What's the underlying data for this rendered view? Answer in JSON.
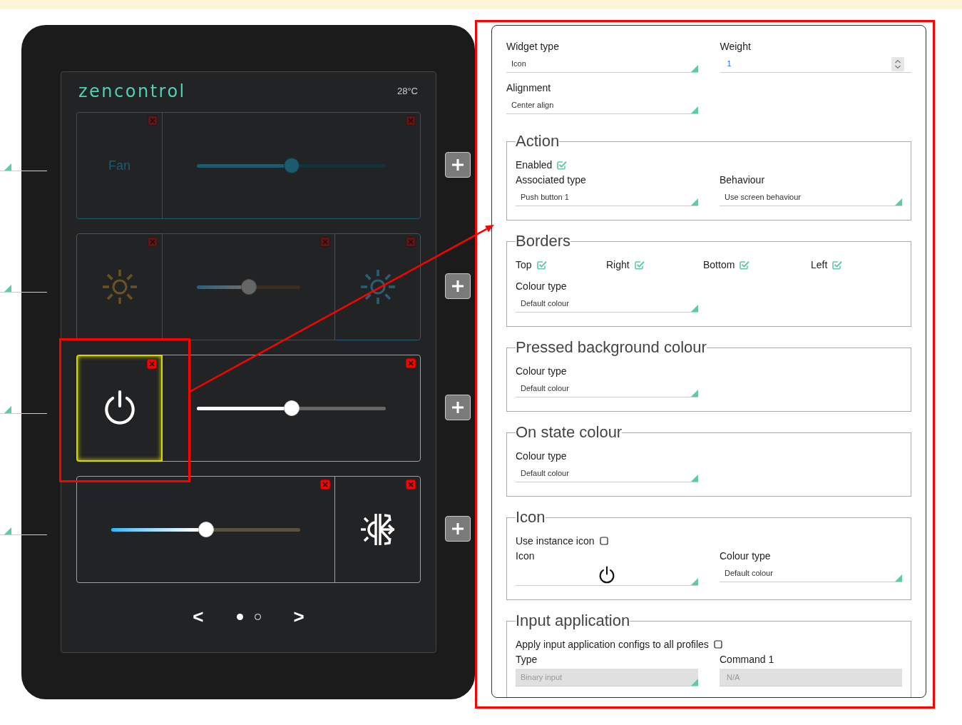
{
  "device": {
    "logo": "zencontrol",
    "temperature": "28°C",
    "rows": [
      {
        "dimmed": true,
        "tiles": [
          {
            "kind": "label",
            "text": "Fan",
            "color": "#1e5a6e",
            "selected": false
          },
          {
            "kind": "slider",
            "slider": {
              "kind": "accent",
              "level": 0.5
            },
            "color": "#1e5a6e",
            "selected": false
          }
        ]
      },
      {
        "dimmed": true,
        "tiles": [
          {
            "kind": "sun",
            "color": "#6b5022",
            "selected": false
          },
          {
            "kind": "slider",
            "slider": {
              "kind": "dual",
              "level": 0.5
            },
            "selected": false
          },
          {
            "kind": "sun",
            "color": "#2b5d72",
            "selected": false
          }
        ]
      },
      {
        "dimmed": false,
        "tiles": [
          {
            "kind": "power",
            "selected": true
          },
          {
            "kind": "slider",
            "slider": {
              "kind": "plain",
              "level": 0.5
            },
            "selected": false
          }
        ]
      },
      {
        "dimmed": false,
        "tiles": [
          {
            "kind": "slider",
            "slider": {
              "kind": "temperature",
              "level": 0.5
            },
            "selected": false
          },
          {
            "kind": "climate",
            "selected": false
          }
        ]
      }
    ],
    "pager": {
      "previous": "<",
      "next": ">",
      "pages": [
        {
          "selected": true
        },
        {
          "selected": false
        }
      ]
    }
  },
  "settings": {
    "rows": [
      {
        "items": [
          {
            "kind": "select",
            "label": "Widget type",
            "value": "Icon",
            "disabled": false
          },
          {
            "kind": "number",
            "label": "Weight",
            "value": "1",
            "disabled": false
          }
        ]
      },
      {
        "items": [
          {
            "kind": "select",
            "label": "Alignment",
            "value": "Center align",
            "disabled": false
          }
        ]
      }
    ],
    "sections": [
      {
        "title": "Action",
        "rows": [
          {
            "items": [
              {
                "kind": "checkbox",
                "label": "Enabled",
                "checked": true
              }
            ]
          },
          {
            "items": [
              {
                "kind": "select",
                "label": "Associated type",
                "value": "Push button 1",
                "disabled": false
              },
              {
                "kind": "select",
                "label": "Behaviour",
                "value": "Use screen behaviour",
                "disabled": false
              }
            ]
          }
        ]
      },
      {
        "title": "Borders",
        "rows": [
          {
            "items": [
              {
                "kind": "checkbox",
                "label": "Top",
                "checked": true
              },
              {
                "kind": "checkbox",
                "label": "Right",
                "checked": true
              },
              {
                "kind": "checkbox",
                "label": "Bottom",
                "checked": true
              },
              {
                "kind": "checkbox",
                "label": "Left",
                "checked": true
              }
            ]
          },
          {
            "items": [
              {
                "kind": "select",
                "label": "Colour type",
                "value": "Default colour",
                "disabled": false
              }
            ]
          }
        ]
      },
      {
        "title": "Pressed background colour",
        "rows": [
          {
            "items": [
              {
                "kind": "select",
                "label": "Colour type",
                "value": "Default colour",
                "disabled": false
              }
            ]
          }
        ]
      },
      {
        "title": "On state colour",
        "rows": [
          {
            "items": [
              {
                "kind": "select",
                "label": "Colour type",
                "value": "Default colour",
                "disabled": false
              }
            ]
          }
        ]
      },
      {
        "title": "Icon",
        "rows": [
          {
            "items": [
              {
                "kind": "checkbox",
                "label": "Use instance icon",
                "checked": false
              }
            ]
          },
          {
            "items": [
              {
                "kind": "icon",
                "label": "Icon",
                "disabled": false
              },
              {
                "kind": "select",
                "label": "Colour type",
                "value": "Default colour",
                "disabled": false
              }
            ]
          }
        ]
      },
      {
        "title": "Input application",
        "rows": [
          {
            "items": [
              {
                "kind": "checkbox",
                "label": "Apply input application configs to all profiles",
                "checked": false
              }
            ]
          },
          {
            "items": [
              {
                "kind": "select",
                "label": "Type",
                "value": "Binary input",
                "disabled": true
              },
              {
                "kind": "text",
                "label": "Command 1",
                "value": "N/A",
                "disabled": true
              }
            ]
          }
        ]
      }
    ]
  }
}
